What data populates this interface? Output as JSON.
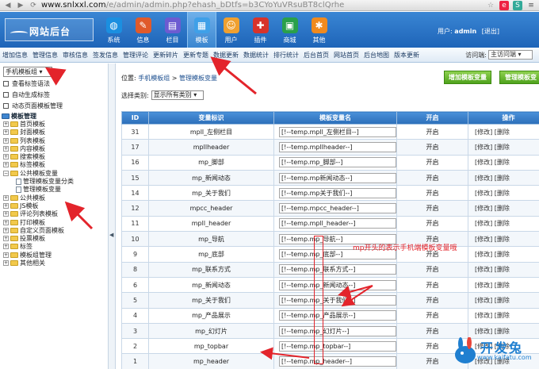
{
  "browser": {
    "url_host": "www.snlxxl.com",
    "url_path": "/e/admin/admin.php?ehash_bDtfs=b3CYoYuVRsuBT8clQrhe"
  },
  "header": {
    "logo": "网站后台",
    "nav": [
      {
        "label": "系统",
        "icon": "globe-icon",
        "color": "#1b8fe0"
      },
      {
        "label": "信息",
        "icon": "edit-icon",
        "color": "#e05a2b"
      },
      {
        "label": "栏目",
        "icon": "folder-icon",
        "color": "#6c5bd1"
      },
      {
        "label": "模板",
        "icon": "template-icon",
        "color": "#3fa0e8"
      },
      {
        "label": "用户",
        "icon": "user-icon",
        "color": "#f0a030"
      },
      {
        "label": "插件",
        "icon": "puzzle-icon",
        "color": "#d7332b"
      },
      {
        "label": "商城",
        "icon": "shop-icon",
        "color": "#2aa04a"
      },
      {
        "label": "其他",
        "icon": "gear-icon",
        "color": "#f08a1e"
      }
    ],
    "active_nav": "模板",
    "user_label": "用户:",
    "user_name": "admin",
    "logout": "[退出]"
  },
  "submenu": {
    "items": [
      "增加信息",
      "管理信息",
      "审核信息",
      "签发信息",
      "管理评论",
      "更新碎片",
      "更新专题",
      "数据更新",
      "数据统计",
      "排行统计",
      "后台首页",
      "网站首页",
      "后台地图",
      "版本更新"
    ],
    "visit_label": "访问端:",
    "visit_value": "主访问端"
  },
  "sidebar": {
    "group_select": "手机模板组",
    "links": [
      "查看标签语法",
      "自动生成标签",
      "动态页面模板管理"
    ],
    "tree": [
      {
        "label": "模板管理",
        "level": 0,
        "type": "root"
      },
      {
        "label": "首页模板",
        "level": 1,
        "type": "folder"
      },
      {
        "label": "封面模板",
        "level": 1,
        "type": "folder"
      },
      {
        "label": "列表模板",
        "level": 1,
        "type": "folder"
      },
      {
        "label": "内容模板",
        "level": 1,
        "type": "folder"
      },
      {
        "label": "搜索模板",
        "level": 1,
        "type": "folder"
      },
      {
        "label": "标签模板",
        "level": 1,
        "type": "folder"
      },
      {
        "label": "公共模板变量",
        "level": 1,
        "type": "folder-open"
      },
      {
        "label": "管理模板变量分类",
        "level": 2,
        "type": "doc"
      },
      {
        "label": "管理模板变量",
        "level": 2,
        "type": "doc"
      },
      {
        "label": "公共模板",
        "level": 1,
        "type": "folder"
      },
      {
        "label": "JS模板",
        "level": 1,
        "type": "folder"
      },
      {
        "label": "评论列表模板",
        "level": 1,
        "type": "folder"
      },
      {
        "label": "打印模板",
        "level": 1,
        "type": "folder"
      },
      {
        "label": "自定义页面模板",
        "level": 1,
        "type": "folder"
      },
      {
        "label": "投票模板",
        "level": 1,
        "type": "folder"
      },
      {
        "label": "标签",
        "level": 1,
        "type": "folder"
      },
      {
        "label": "模板组管理",
        "level": 1,
        "type": "folder"
      },
      {
        "label": "其他相关",
        "level": 1,
        "type": "folder"
      }
    ]
  },
  "main": {
    "breadcrumb_prefix": "位置:",
    "breadcrumb_link1": "手机模板组",
    "breadcrumb_sep": ">",
    "breadcrumb_link2": "管理模板变量",
    "add_button": "增加模板变量",
    "manage_button": "管理模板变",
    "filter_label": "选择类别:",
    "filter_value": "显示所有类别",
    "table": {
      "headers": [
        "ID",
        "变量标识",
        "模板变量名",
        "开启",
        "操作"
      ],
      "rows": [
        {
          "id": "31",
          "flag": "mpll_左侧栏目",
          "name": "[!--temp.mpll_左侧栏目--]",
          "open": "开启",
          "ops": "[修改] [删除"
        },
        {
          "id": "17",
          "flag": "mpllheader",
          "name": "[!--temp.mpllheader--]",
          "open": "开启",
          "ops": "[修改] [删除"
        },
        {
          "id": "16",
          "flag": "mp_脚部",
          "name": "[!--temp.mp_脚部--]",
          "open": "开启",
          "ops": "[修改] [删除"
        },
        {
          "id": "15",
          "flag": "mp_新闻动态",
          "name": "[!--temp.mp新闻动态--]",
          "open": "开启",
          "ops": "[修改] [删除"
        },
        {
          "id": "14",
          "flag": "mp_关于我们",
          "name": "[!--temp.mp关于我们--]",
          "open": "开启",
          "ops": "[修改] [删除"
        },
        {
          "id": "12",
          "flag": "mpcc_header",
          "name": "[!--temp.mpcc_header--]",
          "open": "开启",
          "ops": "[修改] [删除"
        },
        {
          "id": "11",
          "flag": "mpll_header",
          "name": "[!--temp.mpll_header--]",
          "open": "开启",
          "ops": "[修改] [删除"
        },
        {
          "id": "10",
          "flag": "mp_导航",
          "name": "[!--temp.mp_导航--]",
          "open": "开启",
          "ops": "[修改] [删除"
        },
        {
          "id": "9",
          "flag": "mp_底部",
          "name": "[!--temp.mp_底部--]",
          "open": "开启",
          "ops": "[修改] [删除"
        },
        {
          "id": "8",
          "flag": "mp_联系方式",
          "name": "[!--temp.mp_联系方式--]",
          "open": "开启",
          "ops": "[修改] [删除"
        },
        {
          "id": "6",
          "flag": "mp_新闻动态",
          "name": "[!--temp.mp_新闻动态--]",
          "open": "开启",
          "ops": "[修改] [删除"
        },
        {
          "id": "5",
          "flag": "mp_关于我们",
          "name": "[!--temp.mp_关于我们--]",
          "open": "开启",
          "ops": "[修改] [删除"
        },
        {
          "id": "4",
          "flag": "mp_产品展示",
          "name": "[!--temp.mp_产品展示--]",
          "open": "开启",
          "ops": "[修改] [删除"
        },
        {
          "id": "3",
          "flag": "mp_幻灯片",
          "name": "[!--temp.mp_幻灯片--]",
          "open": "开启",
          "ops": "[修改] [删除"
        },
        {
          "id": "2",
          "flag": "mp_topbar",
          "name": "[!--temp.mp_topbar--]",
          "open": "开启",
          "ops": "[修改] [删除"
        },
        {
          "id": "1",
          "flag": "mp_header",
          "name": "[!--temp.mp_header--]",
          "open": "开启",
          "ops": "[修改] [删除"
        }
      ]
    }
  },
  "annotation": {
    "note": "mp开头的表示手机端模板变量哦",
    "color": "#e3242b"
  },
  "watermark": {
    "text": "开发兔",
    "url": "www.kaifatu.com"
  }
}
